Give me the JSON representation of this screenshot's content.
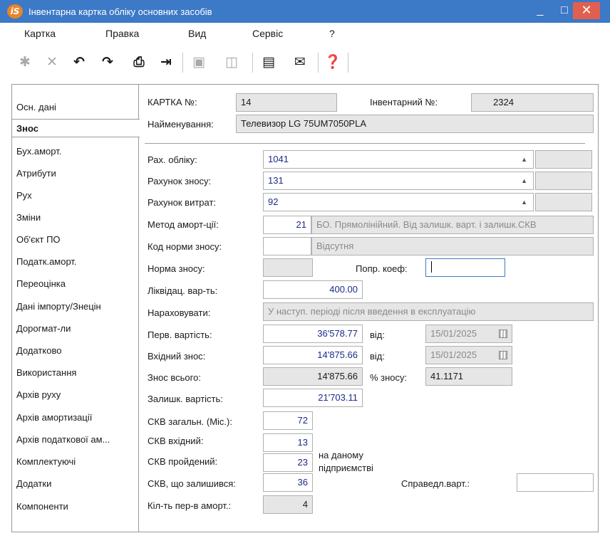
{
  "window": {
    "title": "Інвентарна картка обліку основних засобів",
    "logo": "iS",
    "minimize": "_",
    "maximize": "□",
    "close": "✕"
  },
  "menu": [
    "Картка",
    "Правка",
    "Вид",
    "Сервіс",
    "?"
  ],
  "toolbar": {
    "icons": [
      "new-card-icon",
      "delete-card-icon",
      "undo-icon",
      "redo-icon",
      "print-icon",
      "exit-icon",
      "save-icon",
      "book-icon",
      "form-icon",
      "mail-icon",
      "help-icon"
    ]
  },
  "nav": [
    "Осн. дані",
    "Знос",
    "Бух.аморт.",
    "Атрибути",
    "Рух",
    "Зміни",
    "Об'єкт ПО",
    "Податк.аморт.",
    "Переоцінка",
    "Дані імпорту/Знецін",
    "Дорогмат-ли",
    "Додатково",
    "Використання",
    "Архів руху",
    "Архів амортизації",
    "Архів податкової ам...",
    "Комплектуючі",
    "Додатки",
    "Компоненти"
  ],
  "header": {
    "card_no_label": "КАРТКА №:",
    "card_no": "14",
    "inv_no_label": "Інвентарний №:",
    "inv_no": "2324",
    "name_label": "Найменування:",
    "name": "Телевизор LG 75UM7050PLA"
  },
  "form": {
    "acc_label": "Рах. обліку:",
    "acc_value": "1041",
    "dep_acc_label": "Рахунок зносу:",
    "dep_acc_value": "131",
    "exp_acc_label": "Рахунок витрат:",
    "exp_acc_value": "92",
    "method_label": "Метод аморт-ції:",
    "method_code": "21",
    "method_name": "БО. Прямолінійний. Від залишк. варт. і залишк.СКВ",
    "norm_code_label": "Код норми зносу:",
    "norm_code": "",
    "norm_code_name": "Відсутня",
    "norm_label": "Норма зносу:",
    "norm_value": "",
    "coef_label": "Попр. коеф:",
    "coef_value": "",
    "liq_label": "Ліквідац. вар-ть:",
    "liq_value": "400.00",
    "accrue_label": "Нараховувати:",
    "accrue_value": "У наступ. періоді після введення в експлуатацію",
    "init_cost_label": "Перв. вартість:",
    "init_cost": "36'578.77",
    "init_from_label": "від:",
    "init_date": "15/01/2025",
    "in_dep_label": "Вхідний знос:",
    "in_dep": "14'875.66",
    "in_from_label": "від:",
    "in_date": "15/01/2025",
    "total_dep_label": "Знос всього:",
    "total_dep": "14'875.66",
    "pct_label": "% зносу:",
    "pct_value": "41.1171",
    "residual_label": "Залишк. вартість:",
    "residual": "21'703.11",
    "skv_total_label": "СКВ загальн. (Міс.):",
    "skv_total": "72",
    "skv_in_label": "СКВ вхідний:",
    "skv_in": "13",
    "skv_passed_label": "СКВ пройдений:",
    "skv_passed": "23",
    "enterprise_note_1": "на даному",
    "enterprise_note_2": "підприємстві",
    "skv_left_label": "СКВ, що залишився:",
    "skv_left": "36",
    "fair_label": "Справедл.варт.:",
    "fair_value": "",
    "periods_label": "Кіл-ть пер-в аморт.:",
    "periods": "4"
  }
}
